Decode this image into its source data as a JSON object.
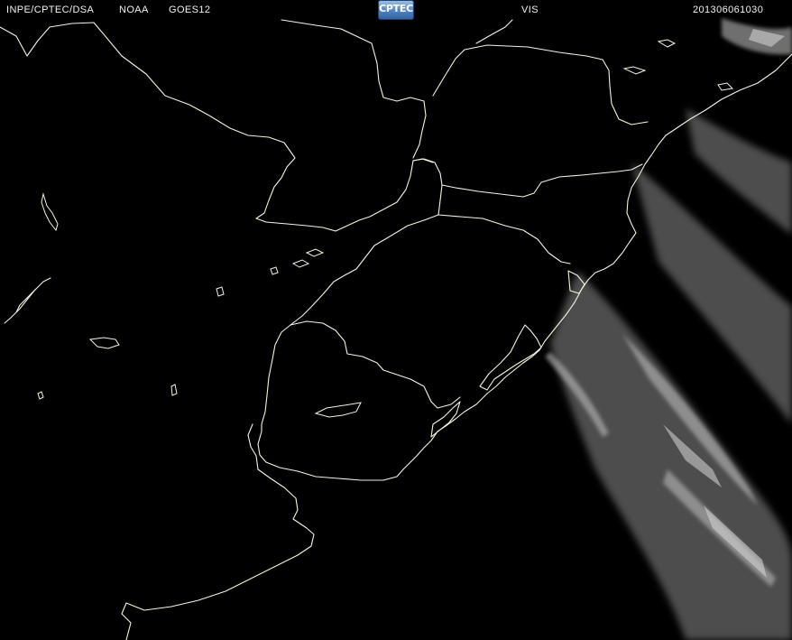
{
  "header": {
    "agency": "INPE/CPTEC/DSA",
    "operator": "NOAA",
    "satellite": "GOES12",
    "logo_text": "CPTEC",
    "channel": "VIS",
    "timestamp": "201306061030"
  },
  "colors": {
    "background": "#000000",
    "boundary": "#f4f4e2",
    "header_text": "#f2f2f2",
    "cloud": "#bdbdbd"
  }
}
